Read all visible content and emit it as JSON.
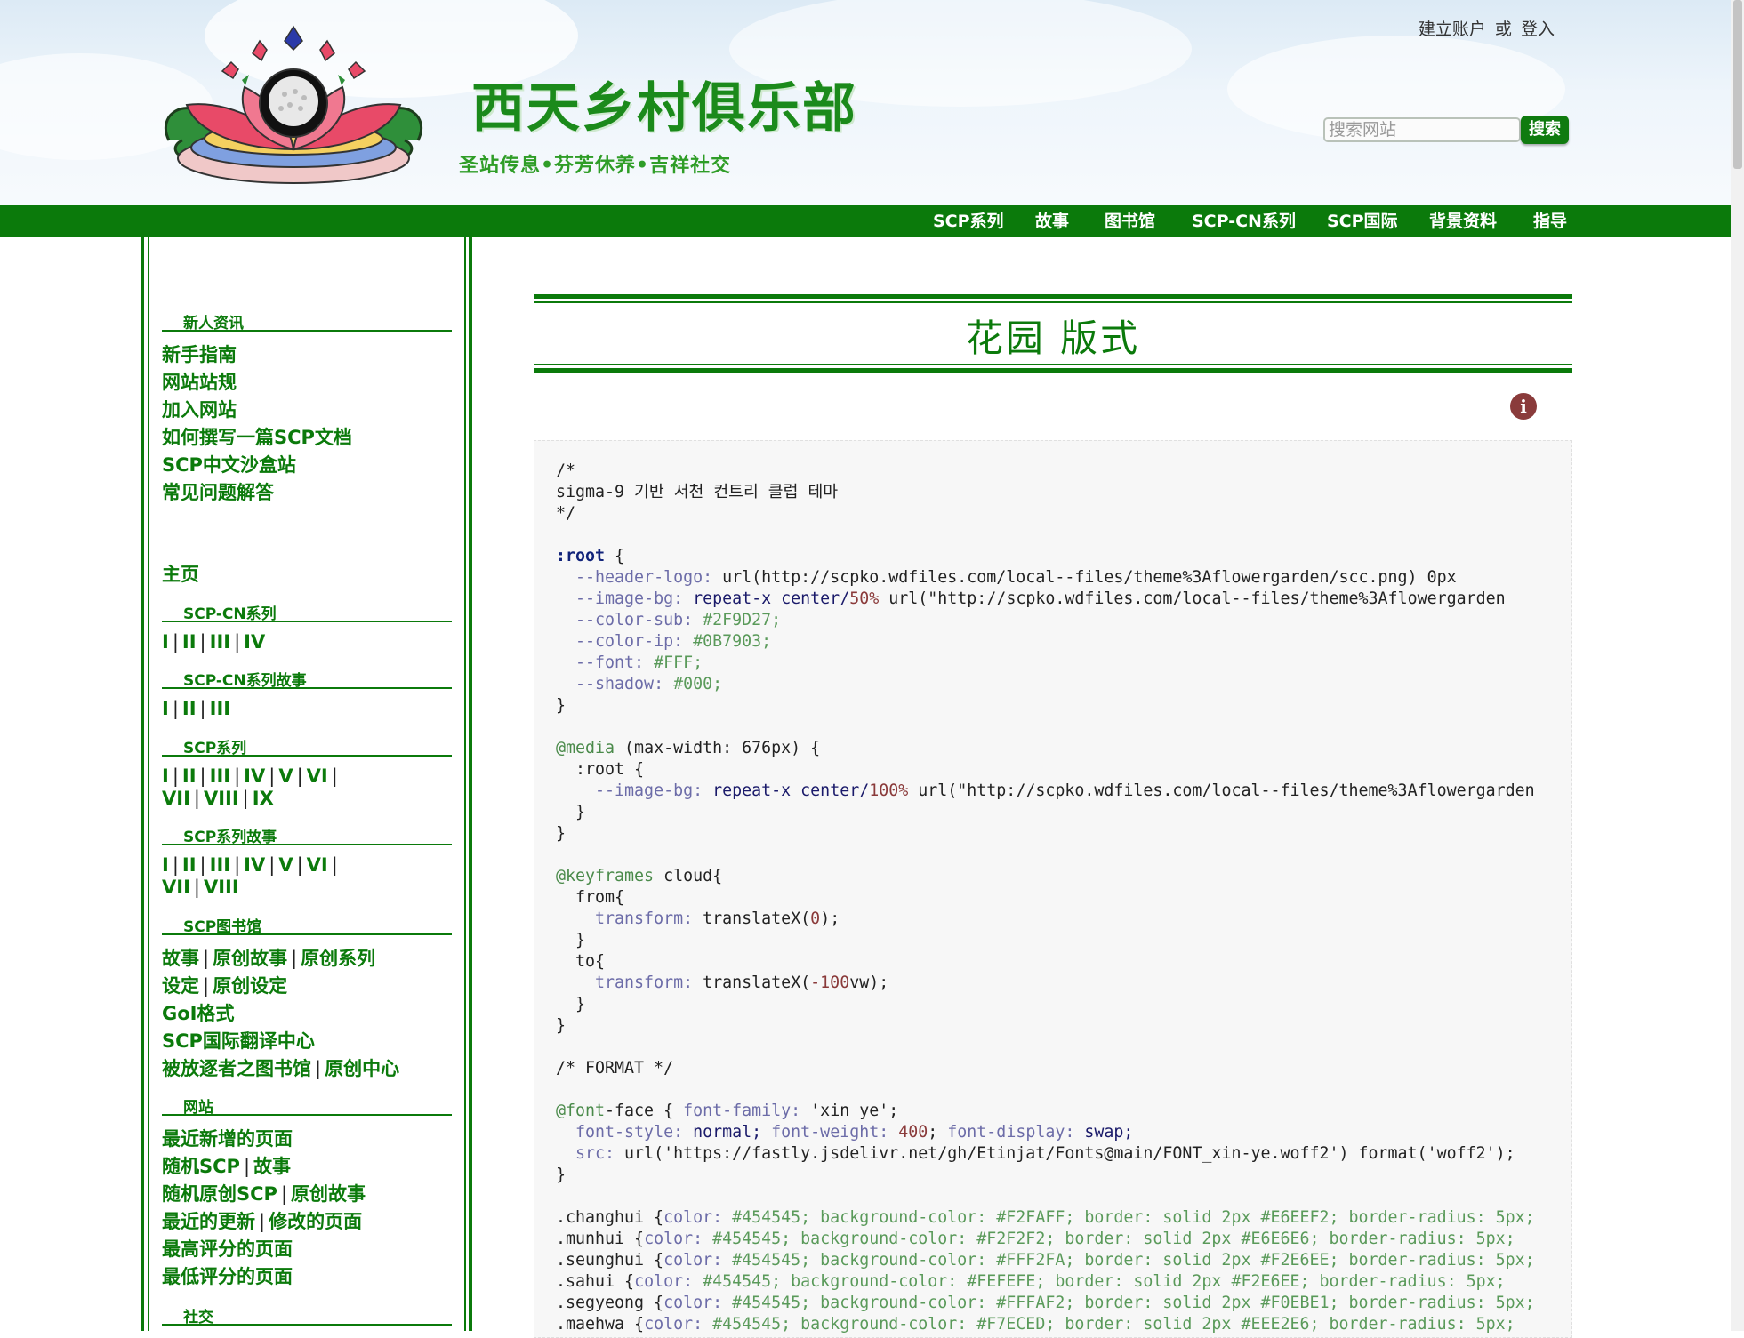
{
  "header": {
    "site_name": "西天乡村俱乐部",
    "site_slogan": "圣站传息•芬芳休养•吉祥社交",
    "account": {
      "create": "建立账户",
      "or": "或",
      "login": "登入"
    },
    "search": {
      "placeholder": "搜索网站",
      "button": "搜索"
    }
  },
  "top_nav": [
    "SCP系列",
    "故事",
    "图书馆",
    "SCP-CN系列",
    "SCP国际",
    "背景资料",
    "指导"
  ],
  "sidebar": {
    "newbie_heading": "新人资讯",
    "newbie_links": [
      "新手指南",
      "网站站规",
      "加入网站",
      "如何撰写一篇SCP文档",
      "SCP中文沙盒站",
      "常见问题解答"
    ],
    "home": "主页",
    "cn_series_heading": "SCP-CN系列",
    "cn_series": [
      "I",
      "II",
      "III",
      "IV"
    ],
    "cn_tales_heading": "SCP-CN系列故事",
    "cn_tales": [
      "I",
      "II",
      "III"
    ],
    "series_heading": "SCP系列",
    "series_row1": [
      "I",
      "II",
      "III",
      "IV",
      "V",
      "VI"
    ],
    "series_row2": [
      "VII",
      "VIII",
      "IX"
    ],
    "tales_heading": "SCP系列故事",
    "tales_row1": [
      "I",
      "II",
      "III",
      "IV",
      "V",
      "VI"
    ],
    "tales_row2": [
      "VII",
      "VIII"
    ],
    "library_heading": "SCP图书馆",
    "library_row1": [
      "故事",
      "原创故事",
      "原创系列"
    ],
    "library_row2": [
      "设定",
      "原创设定"
    ],
    "library_row3": "GoI格式",
    "library_row4": "SCP国际翻译中心",
    "library_row5": [
      "被放逐者之图书馆",
      "原创中心"
    ],
    "site_heading": "网站",
    "site_row1": "最近新增的页面",
    "site_row2": [
      "随机SCP",
      "故事"
    ],
    "site_row3": [
      "随机原创SCP",
      "原创故事"
    ],
    "site_row4": [
      "最近的更新",
      "修改的页面"
    ],
    "site_row5": "最高评分的页面",
    "site_row6": "最低评分的页面",
    "social_heading": "社交"
  },
  "main": {
    "page_title": "花园 版式",
    "info_icon": "i",
    "code": {
      "l1": "/*",
      "l2": "sigma-9 기반 서천 컨트리 클럽 테마",
      "l3": "*/",
      "root_sel": ":root",
      "root_open": " {",
      "r1_prop": "--header-logo:",
      "r1_val": " url(http://scpko.wdfiles.com/local--files/theme%3Aflowergarden/scc.png) 0px",
      "r2_prop": "--image-bg:",
      "r2_val1": " repeat-x center/",
      "r2_num": "50%",
      "r2_val2": " url(\"http://scpko.wdfiles.com/local--files/theme%3Aflowergarden",
      "r3_prop": "--color-sub:",
      "r3_val": " #2F9D27;",
      "r4_prop": "--color-ip:",
      "r4_val": " #0B7903;",
      "r5_prop": "--font:",
      "r5_val": " #FFF;",
      "r6_prop": "--shadow:",
      "r6_val": " #000;",
      "close": "}",
      "media_at": "@media",
      "media_rest": " (max-width: 676px) {",
      "media_root": "  :root {",
      "m1_prop": "--image-bg:",
      "m1_val1": " repeat-x center/",
      "m1_num": "100%",
      "m1_val2": " url(\"http://scpko.wdfiles.com/local--files/theme%3Aflowergarden",
      "inner_close": "  }",
      "kf_at": "@keyframes",
      "kf_rest": " cloud{",
      "from": "  from{",
      "t1_prop": "transform:",
      "t1_val1": " translateX(",
      "t1_num": "0",
      "t1_val2": ");",
      "to": "  to{",
      "t2_prop": "transform:",
      "t2_val1": " translateX(",
      "t2_num": "-100",
      "t2_val2": "vw);",
      "format_comment": "/* FORMAT */",
      "ff_at": "@font",
      "ff_rest": "-face { ",
      "ff_p1": "font-family:",
      "ff_v1": " 'xin ye';",
      "ff_p2": "font-style:",
      "ff_v2": " normal; ",
      "ff_p3": "font-weight:",
      "ff_v3": " 400",
      "ff_p4": "font-display:",
      "ff_v4": " swap;",
      "ff_p5": "src:",
      "ff_v5": " url('https://fastly.jsdelivr.net/gh/Etinjat/Fonts@main/FONT_xin-ye.woff2') format('woff2');",
      "cls1": ".changhui {",
      "cls1_rest": "#454545; background-color: #F2FAFF; border: solid 2px #E6EEF2; border-radius: 5px;",
      "cls2": ".munhui {",
      "cls2_rest": "#454545; background-color: #F2F2F2; border: solid 2px #E6E6E6; border-radius: 5px;",
      "cls3": ".seunghui {",
      "cls3_rest": "#454545; background-color: #FFF2FA; border: solid 2px #F2E6EE; border-radius: 5px;",
      "cls4": ".sahui {",
      "cls4_rest": "#454545; background-color: #FEFEFE; border: solid 2px #F2E6EE; border-radius: 5px;",
      "cls5": ".segyeong {",
      "cls5_rest": "#454545; background-color: #FFFAF2; border: solid 2px #F0EBE1; border-radius: 5px;",
      "cls6": ".maehwa {",
      "cls6_rest": "#454545; background-color: #F7ECED; border: solid 2px #EEE2E6; border-radius: 5px;",
      "color_prop": "color: "
    }
  },
  "colors": {
    "primary": "#0B7A0B",
    "sub": "#2F9D27",
    "info": "#8A3B3B"
  }
}
